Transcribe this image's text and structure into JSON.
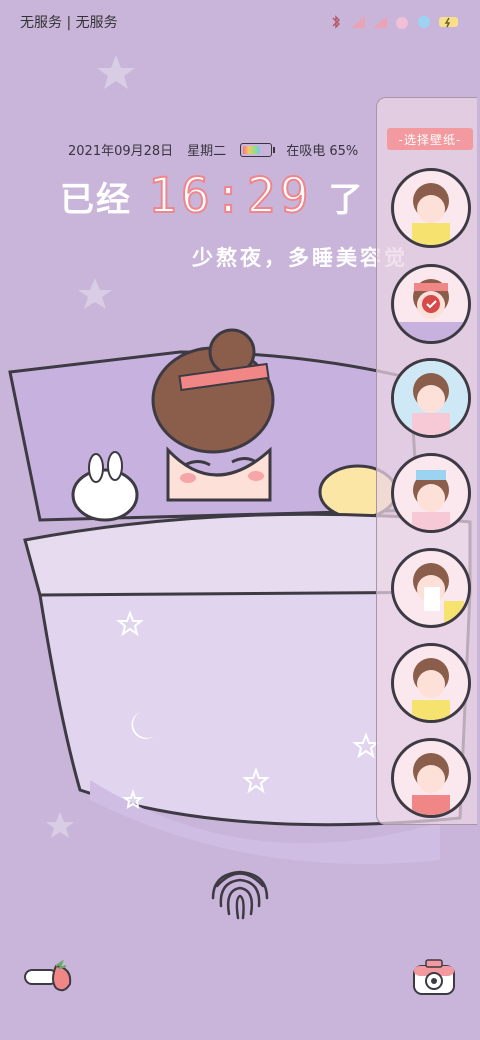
{
  "status_bar": {
    "carrier": "无服务 | 无服务",
    "icons": [
      "bluetooth-icon",
      "signal-icon",
      "signal-icon",
      "wifi-icon",
      "alarm-icon",
      "battery-charging-icon"
    ]
  },
  "lock": {
    "date": "2021年09月28日",
    "weekday": "星期二",
    "battery_status": "在吸电 65%",
    "battery_level": 0.65,
    "clock_prefix": "已经",
    "time": "16:29",
    "clock_suffix": "了",
    "tagline": "少熬夜，多睡美容觉"
  },
  "wallpaper_panel": {
    "title": "-选择壁纸-",
    "selected_index": 1,
    "count": 7
  },
  "colors": {
    "background": "#c9b5da",
    "accent_pink": "#f29a9f",
    "outline": "#3e3a44"
  }
}
